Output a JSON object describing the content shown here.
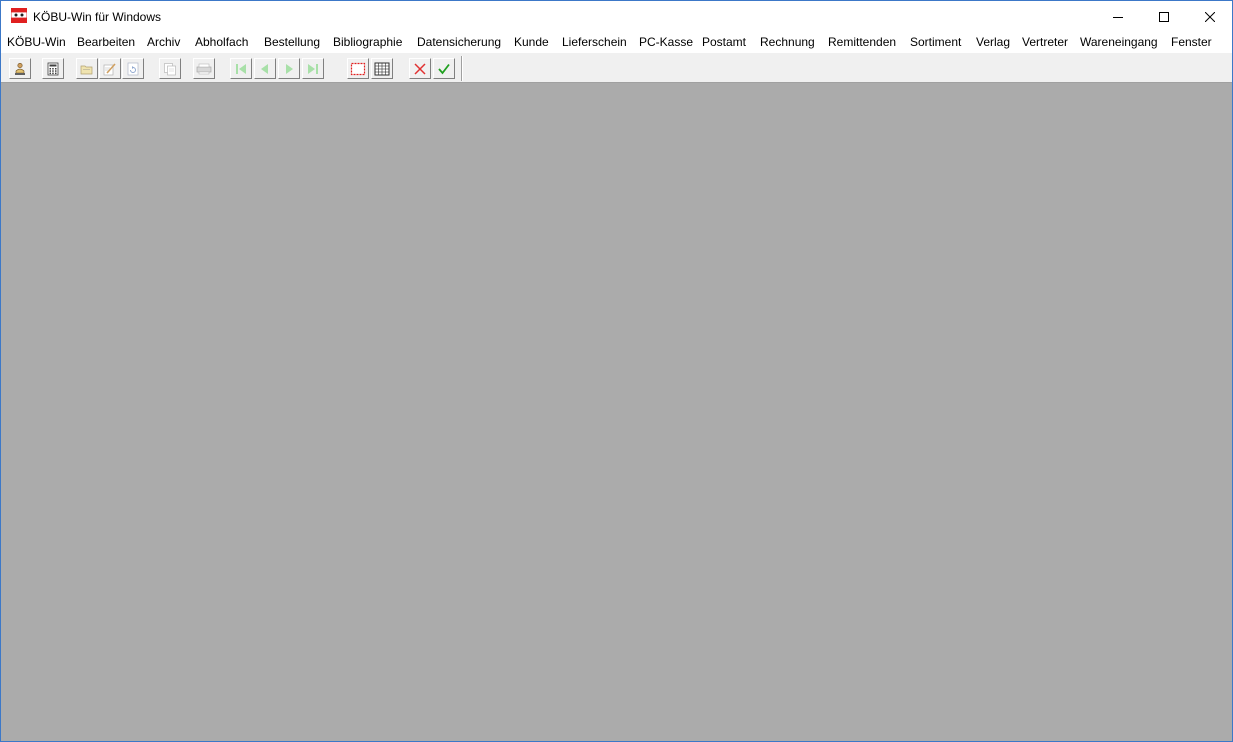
{
  "window": {
    "title": "KÖBU-Win für Windows"
  },
  "menu": [
    {
      "label": "KÖBU-Win"
    },
    {
      "label": "Bearbeiten"
    },
    {
      "label": "Archiv"
    },
    {
      "label": "Abholfach"
    },
    {
      "label": "Bestellung"
    },
    {
      "label": "Bibliographie"
    },
    {
      "label": "Datensicherung"
    },
    {
      "label": "Kunde"
    },
    {
      "label": "Lieferschein"
    },
    {
      "label": "PC-Kasse"
    },
    {
      "label": "Postamt"
    },
    {
      "label": "Rechnung"
    },
    {
      "label": "Remittenden"
    },
    {
      "label": "Sortiment"
    },
    {
      "label": "Verlag"
    },
    {
      "label": "Vertreter"
    },
    {
      "label": "Wareneingang"
    },
    {
      "label": "Fenster"
    }
  ],
  "toolbar": {
    "buttons": [
      {
        "icon": "user-icon",
        "enabled": true
      },
      {
        "icon": "calculator-icon",
        "enabled": true
      },
      {
        "icon": "open-folder-icon",
        "enabled": false
      },
      {
        "icon": "edit-icon",
        "enabled": false
      },
      {
        "icon": "refresh-icon",
        "enabled": false
      },
      {
        "icon": "copy-icon",
        "enabled": false
      },
      {
        "icon": "print-icon",
        "enabled": false
      },
      {
        "icon": "first-record-icon",
        "enabled": false
      },
      {
        "icon": "previous-record-icon",
        "enabled": false
      },
      {
        "icon": "next-record-icon",
        "enabled": false
      },
      {
        "icon": "last-record-icon",
        "enabled": false
      },
      {
        "icon": "select-frame-icon",
        "enabled": true
      },
      {
        "icon": "grid-icon",
        "enabled": true
      },
      {
        "icon": "cancel-icon",
        "enabled": true
      },
      {
        "icon": "confirm-icon",
        "enabled": true
      }
    ]
  },
  "colors": {
    "client_background": "#ababab",
    "window_border": "#3c78c8",
    "nav_disabled": "#a8e0a8",
    "cancel": "#e03030",
    "confirm": "#20a020"
  }
}
